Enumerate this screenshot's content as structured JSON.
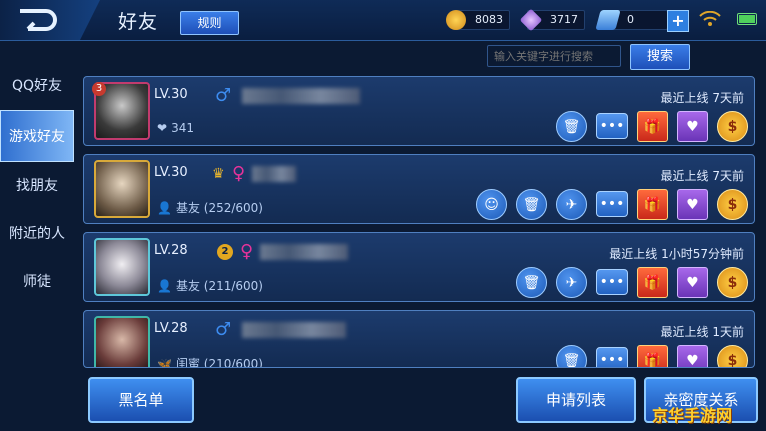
{
  "header": {
    "title": "好友",
    "rules_label": "规则",
    "gold": "8083",
    "diamonds": "3717",
    "coupons": "0",
    "plus_label": "+"
  },
  "sidebar": {
    "items": [
      {
        "label": "QQ好友"
      },
      {
        "label": "游戏好友"
      },
      {
        "label": "找朋友"
      },
      {
        "label": "附近的人"
      },
      {
        "label": "师徒"
      }
    ]
  },
  "search": {
    "placeholder": "输入关键字进行搜索",
    "button_label": "搜索"
  },
  "friends": [
    {
      "level": "LV.30",
      "badge": "3",
      "sub_icon": "❤",
      "sub_text": "341",
      "online": "最近上线  7天前"
    },
    {
      "level": "LV.30",
      "sub_icon": "👤",
      "sub_text": "基友 (252/600)",
      "online": "最近上线  7天前"
    },
    {
      "level": "LV.28",
      "mark": "2",
      "sub_icon": "👤",
      "sub_text": "基友 (211/600)",
      "online": "最近上线  1小时57分钟前"
    },
    {
      "level": "LV.28",
      "sub_icon": "🦋",
      "sub_text": "闺蜜 (210/600)",
      "online": "最近上线  1天前"
    }
  ],
  "bottom": {
    "blacklist": "黑名单",
    "requests": "申请列表",
    "intimacy": "亲密度关系"
  },
  "watermark": "京华手游网",
  "colors": {
    "accent": "#2d7fe0",
    "gold": "#ffcf45",
    "card": "#1c3b6d"
  }
}
